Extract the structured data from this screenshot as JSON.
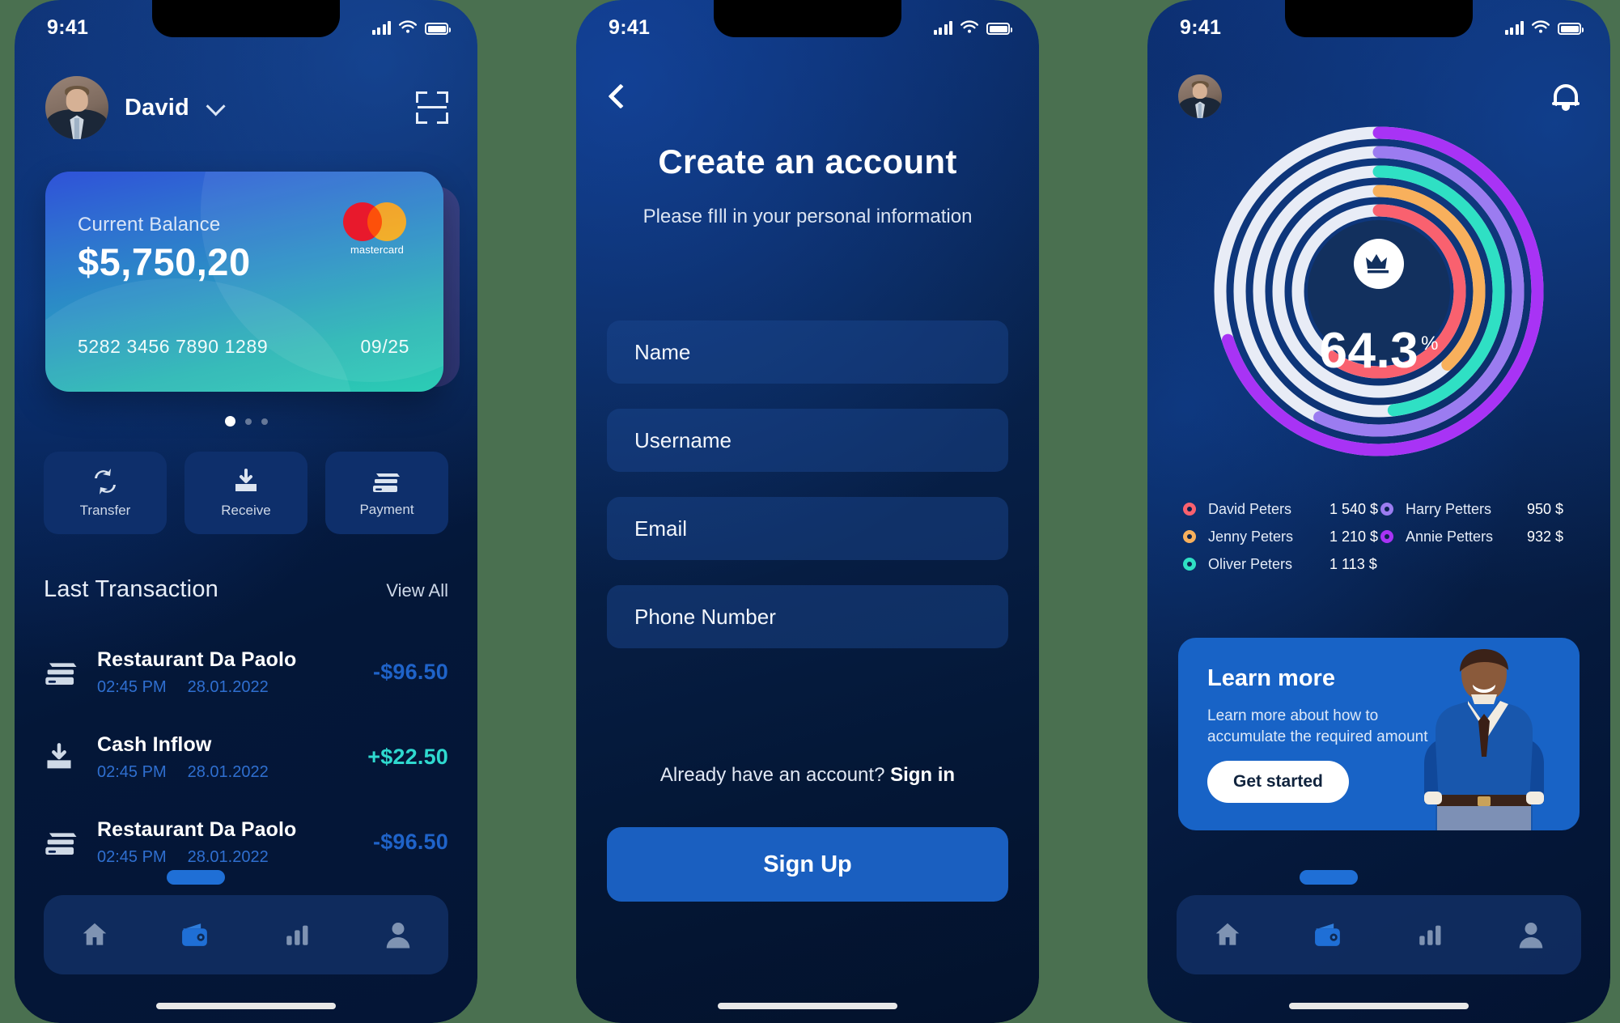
{
  "status_bar": {
    "time": "9:41",
    "signal_icon": "signal-bars-icon",
    "wifi_icon": "wifi-icon",
    "battery_icon": "battery-icon"
  },
  "phone1": {
    "header": {
      "user_name": "David",
      "dropdown_icon": "chevron-down-icon",
      "scan_icon": "scan-qr-icon",
      "avatar": "user-avatar"
    },
    "card": {
      "balance_label": "Current Balance",
      "balance_amount": "$5,750,20",
      "number": "5282 3456 7890 1289",
      "expiry": "09/25",
      "brand": "mastercard",
      "gradient_from": "#2f52d8",
      "gradient_to": "#2dcdb5"
    },
    "carousel": {
      "total": 3,
      "active_index": 0
    },
    "actions": [
      {
        "label": "Transfer",
        "icon": "transfer-arrows-icon"
      },
      {
        "label": "Receive",
        "icon": "download-tray-icon"
      },
      {
        "label": "Payment",
        "icon": "credit-cards-icon"
      }
    ],
    "transactions_header": {
      "title": "Last Transaction",
      "view_all": "View All"
    },
    "transactions": [
      {
        "icon": "credit-cards-icon",
        "name": "Restaurant Da Paolo",
        "time": "02:45 PM",
        "date": "28.01.2022",
        "amount": "-$96.50",
        "direction": "negative"
      },
      {
        "icon": "download-tray-icon",
        "name": "Cash Inflow",
        "time": "02:45 PM",
        "date": "28.01.2022",
        "amount": "+$22.50",
        "direction": "positive"
      },
      {
        "icon": "credit-cards-icon",
        "name": "Restaurant Da Paolo",
        "time": "02:45 PM",
        "date": "28.01.2022",
        "amount": "-$96.50",
        "direction": "negative"
      }
    ],
    "nav": [
      {
        "name": "home",
        "icon": "home-icon",
        "active": false
      },
      {
        "name": "wallet",
        "icon": "wallet-icon",
        "active": true
      },
      {
        "name": "statistics",
        "icon": "bar-chart-icon",
        "active": false
      },
      {
        "name": "profile",
        "icon": "person-icon",
        "active": false
      }
    ]
  },
  "phone2": {
    "back_icon": "chevron-left-icon",
    "title": "Create an account",
    "subtitle": "Please fIll in your personal information",
    "fields": [
      {
        "placeholder": "Name"
      },
      {
        "placeholder": "Username"
      },
      {
        "placeholder": "Email"
      },
      {
        "placeholder": "Phone Number"
      }
    ],
    "signin_prefix": "Already have an account? ",
    "signin_link": "Sign in",
    "cta_label": "Sign Up",
    "cta_color": "#1a5fc0"
  },
  "phone3": {
    "header": {
      "avatar": "user-avatar",
      "bell_icon": "bell-icon"
    },
    "chart_data": {
      "type": "pie",
      "title": "Savings progress rings",
      "center_value": "64.3",
      "center_unit": "%",
      "center_icon": "crown-icon",
      "categories": [
        "David Peters",
        "Jenny Peters",
        "Oliver Peters",
        "Harry Petters",
        "Annie Petters"
      ],
      "values": [
        1540,
        1210,
        1113,
        950,
        932
      ],
      "value_labels": [
        "1 540 $",
        "1 210 $",
        "1 113 $",
        "950 $",
        "932 $"
      ],
      "colors": [
        "#f9616f",
        "#f8b05c",
        "#2fe0c4",
        "#9b7cf0",
        "#a833f5"
      ],
      "ring_percents": [
        60,
        38,
        48,
        57,
        70
      ],
      "track_color": "#e8ecf6",
      "legend": "below-chart"
    },
    "learn": {
      "title": "Learn more",
      "description": "Learn more about how to accumulate the required amount",
      "button_label": "Get started",
      "bg_color": "#1863c6"
    },
    "nav": [
      {
        "name": "home",
        "icon": "home-icon",
        "active": false
      },
      {
        "name": "wallet",
        "icon": "wallet-icon",
        "active": true
      },
      {
        "name": "statistics",
        "icon": "bar-chart-icon",
        "active": false
      },
      {
        "name": "profile",
        "icon": "person-icon",
        "active": false
      }
    ]
  }
}
